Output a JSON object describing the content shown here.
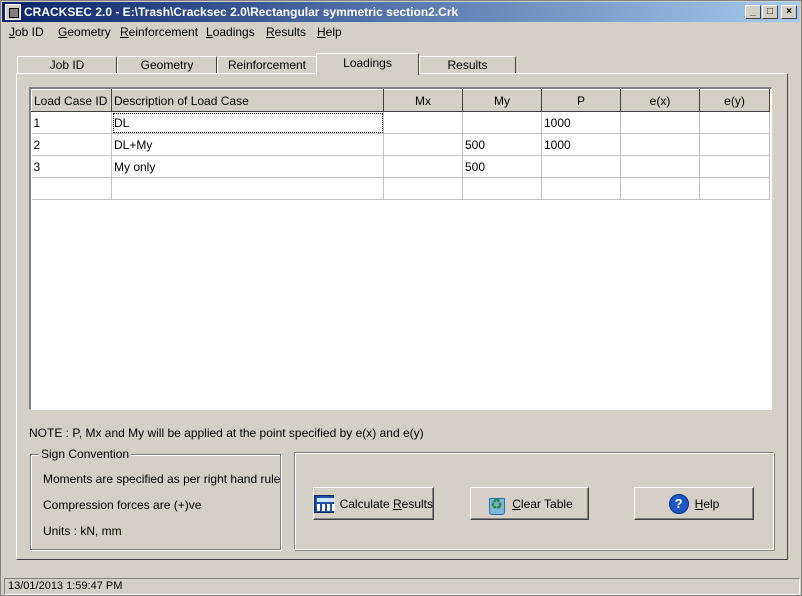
{
  "window": {
    "title": "CRACKSEC 2.0 - E:\\Trash\\Cracksec 2.0\\Rectangular symmetric section2.Crk",
    "minimize": "_",
    "maximize": "□",
    "close": "×"
  },
  "menu": {
    "items": [
      {
        "u": "J",
        "rest": "ob ID"
      },
      {
        "u": "G",
        "rest": "eometry"
      },
      {
        "u": "R",
        "rest": "einforcement"
      },
      {
        "u": "L",
        "rest": "oadings"
      },
      {
        "u": "R",
        "rest": "esults"
      },
      {
        "u": "H",
        "rest": "elp"
      }
    ]
  },
  "tabs": [
    {
      "label": "Job ID"
    },
    {
      "label": "Geometry"
    },
    {
      "label": "Reinforcement"
    },
    {
      "label": "Loadings"
    },
    {
      "label": "Results"
    }
  ],
  "grid": {
    "columns": [
      "Load Case ID",
      "Description of Load Case",
      "Mx",
      "My",
      "P",
      "e(x)",
      "e(y)"
    ],
    "rows": [
      [
        "1",
        "DL",
        "",
        "",
        "1000",
        "",
        ""
      ],
      [
        "2",
        "DL+My",
        "",
        "500",
        "1000",
        "",
        ""
      ],
      [
        "3",
        "My only",
        "",
        "500",
        "",
        "",
        ""
      ],
      [
        "",
        "",
        "",
        "",
        "",
        "",
        ""
      ]
    ]
  },
  "note": "NOTE : P, Mx and My will be applied at the point specified by e(x) and e(y)",
  "sign_convention": {
    "title": "Sign Convention",
    "line1": "Moments are specified as per right hand rule",
    "line2": "Compression forces are (+)ve",
    "line3": "Units :   kN, mm"
  },
  "buttons": {
    "calculate": {
      "pre": "Calculate ",
      "u": "R",
      "post": "esults"
    },
    "clear": {
      "pre": "",
      "u": "C",
      "post": "lear Table"
    },
    "help": {
      "pre": "",
      "u": "H",
      "post": "elp"
    }
  },
  "status": {
    "datetime": "13/01/2013 1:59:47 PM"
  }
}
